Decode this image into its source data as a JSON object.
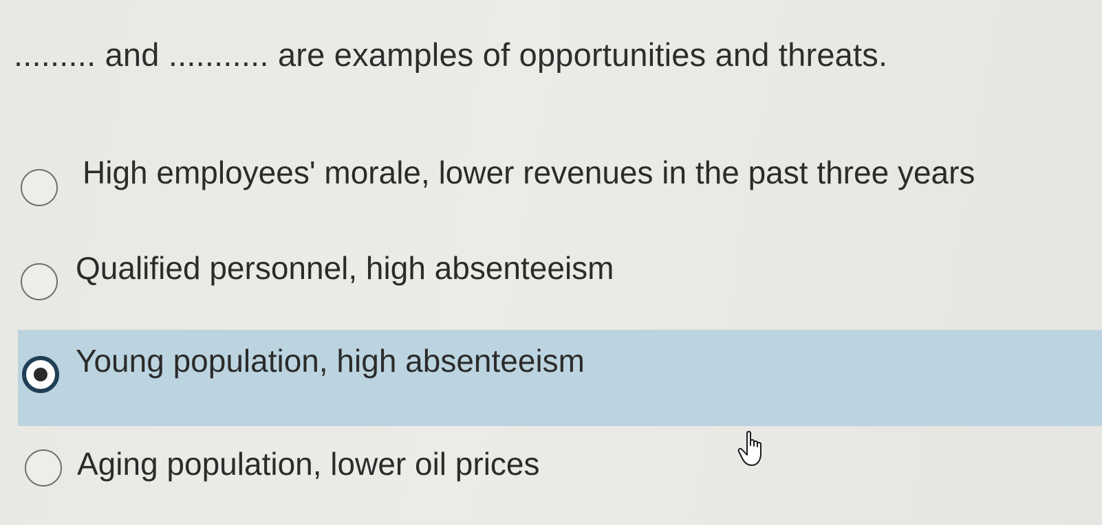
{
  "question": {
    "text": "......... and ........... are examples of opportunities and threats."
  },
  "options": [
    {
      "label": "High employees' morale, lower revenues in the past three years",
      "selected": false
    },
    {
      "label": "Qualified personnel, high absenteeism",
      "selected": false
    },
    {
      "label": "Young population, high absenteeism",
      "selected": true
    },
    {
      "label": "Aging population, lower oil prices",
      "selected": false
    }
  ],
  "colors": {
    "selected_highlight": "#bcd4e0",
    "selected_radio_ring": "#1f3f56",
    "background": "#e9e8e4"
  },
  "icons": {
    "pointer": "hand-pointer-icon"
  }
}
